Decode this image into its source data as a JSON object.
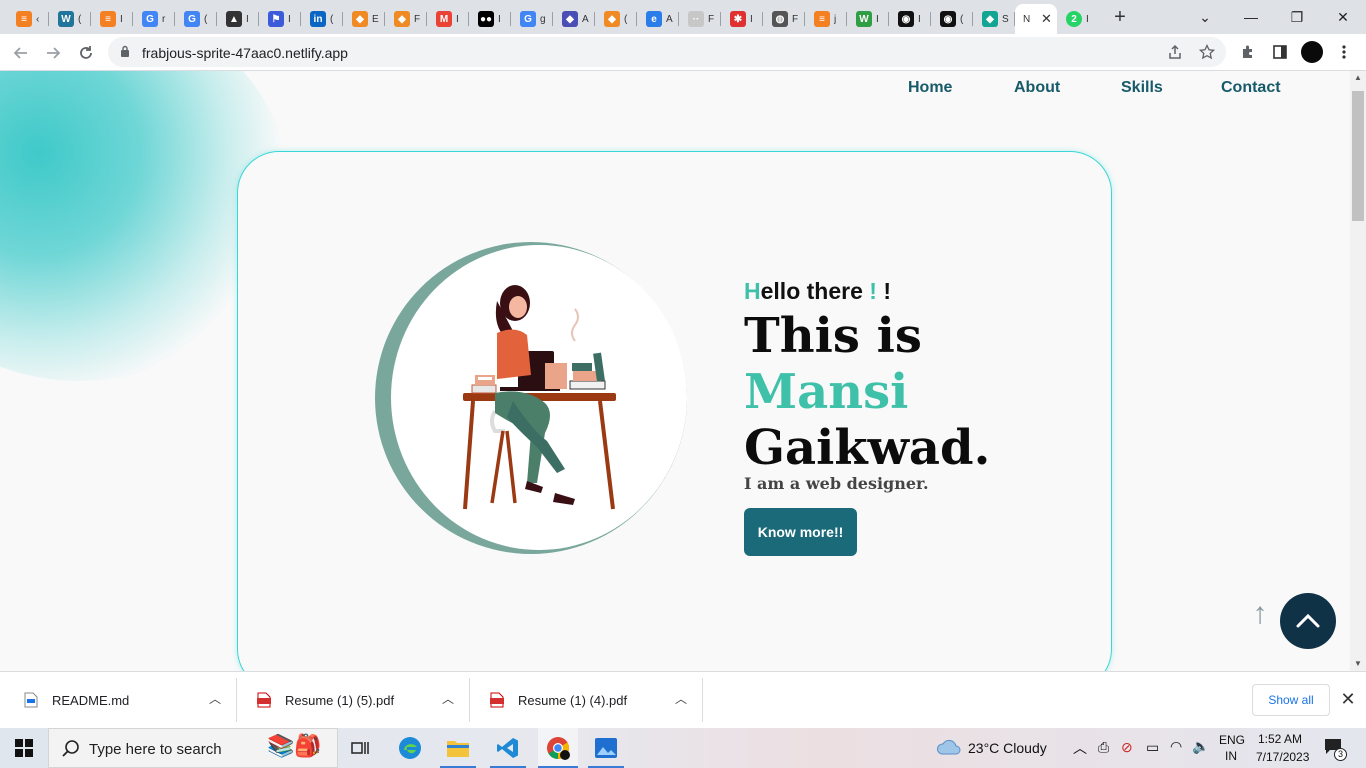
{
  "browser": {
    "tabs": [
      {
        "icon": "stackoverflow-icon",
        "color": "#f48024",
        "glyph": "≡",
        "text": "‹"
      },
      {
        "icon": "wordpress-icon",
        "color": "#21759b",
        "glyph": "W",
        "text": "("
      },
      {
        "icon": "stackoverflow-icon",
        "color": "#f48024",
        "glyph": "≡",
        "text": "I"
      },
      {
        "icon": "google-icon",
        "color": "#4285f4",
        "glyph": "G",
        "text": "r"
      },
      {
        "icon": "google-icon",
        "color": "#4285f4",
        "glyph": "G",
        "text": "("
      },
      {
        "icon": "graduation-cap-icon",
        "color": "#333",
        "glyph": "▲",
        "text": "I"
      },
      {
        "icon": "flag-icon",
        "color": "#3b5bdb",
        "glyph": "⚑",
        "text": "I"
      },
      {
        "icon": "linkedin-icon",
        "color": "#0a66c2",
        "glyph": "in",
        "text": "("
      },
      {
        "icon": "codepen-shield-icon",
        "color": "#f08a24",
        "glyph": "◆",
        "text": "E"
      },
      {
        "icon": "codepen-shield-icon",
        "color": "#f08a24",
        "glyph": "◆",
        "text": "F"
      },
      {
        "icon": "gmail-icon",
        "color": "#ea4335",
        "glyph": "M",
        "text": "I"
      },
      {
        "icon": "medium-icon",
        "color": "#000",
        "glyph": "●●",
        "text": "I"
      },
      {
        "icon": "google-icon",
        "color": "#4285f4",
        "glyph": "G",
        "text": "g"
      },
      {
        "icon": "shield-icon",
        "color": "#4a4fb5",
        "glyph": "◆",
        "text": "A"
      },
      {
        "icon": "codepen-shield-icon",
        "color": "#f08a24",
        "glyph": "◆",
        "text": "("
      },
      {
        "icon": "edge-icon",
        "color": "#2b7de9",
        "glyph": "e",
        "text": "A"
      },
      {
        "icon": "blank-page-icon",
        "color": "#c7c7c7",
        "glyph": "··",
        "text": "F"
      },
      {
        "icon": "asterisk-icon",
        "color": "#e03131",
        "glyph": "✱",
        "text": "I"
      },
      {
        "icon": "globe-icon",
        "color": "#555",
        "glyph": "◍",
        "text": "F"
      },
      {
        "icon": "stackoverflow-icon",
        "color": "#f48024",
        "glyph": "≡",
        "text": "j"
      },
      {
        "icon": "w-logo-icon",
        "color": "#2f9e44",
        "glyph": "W",
        "text": "I"
      },
      {
        "icon": "github-icon",
        "color": "#111",
        "glyph": "◉",
        "text": "I"
      },
      {
        "icon": "github-icon",
        "color": "#111",
        "glyph": "◉",
        "text": "("
      },
      {
        "icon": "diamond-icon",
        "color": "#12a594",
        "glyph": "◆",
        "text": "S"
      }
    ],
    "active_tab": {
      "icon": "page-icon",
      "text": "N",
      "close": "✕"
    },
    "extra_tab": {
      "icon": "whatsapp-badge-icon",
      "color": "#25d366",
      "glyph": "2",
      "text": "I"
    },
    "new_tab": "+",
    "url": "frabjous-sprite-47aac0.netlify.app"
  },
  "page": {
    "nav": [
      "Home",
      "About",
      "Skills",
      "Contact"
    ],
    "greeting": {
      "first": "H",
      "rest": "ello there ",
      "bang1": "!",
      "bang2": " !"
    },
    "line1": "This is",
    "line2": "Mansi",
    "line3": "Gaikwad.",
    "subtitle": "I am a web designer.",
    "button": "Know more!!",
    "accent_color": "#3fc1a9",
    "primary_color": "#1a6a7a"
  },
  "downloads": {
    "items": [
      {
        "name": "README.md",
        "icon": "markdown-file-icon"
      },
      {
        "name": "Resume (1) (5).pdf",
        "icon": "pdf-file-icon"
      },
      {
        "name": "Resume (1) (4).pdf",
        "icon": "pdf-file-icon"
      }
    ],
    "show_all": "Show all"
  },
  "taskbar": {
    "search_placeholder": "Type here to search",
    "weather": "23°C  Cloudy",
    "lang1": "ENG",
    "lang2": "IN",
    "time": "1:52 AM",
    "date": "7/17/2023",
    "notifications": "3"
  }
}
